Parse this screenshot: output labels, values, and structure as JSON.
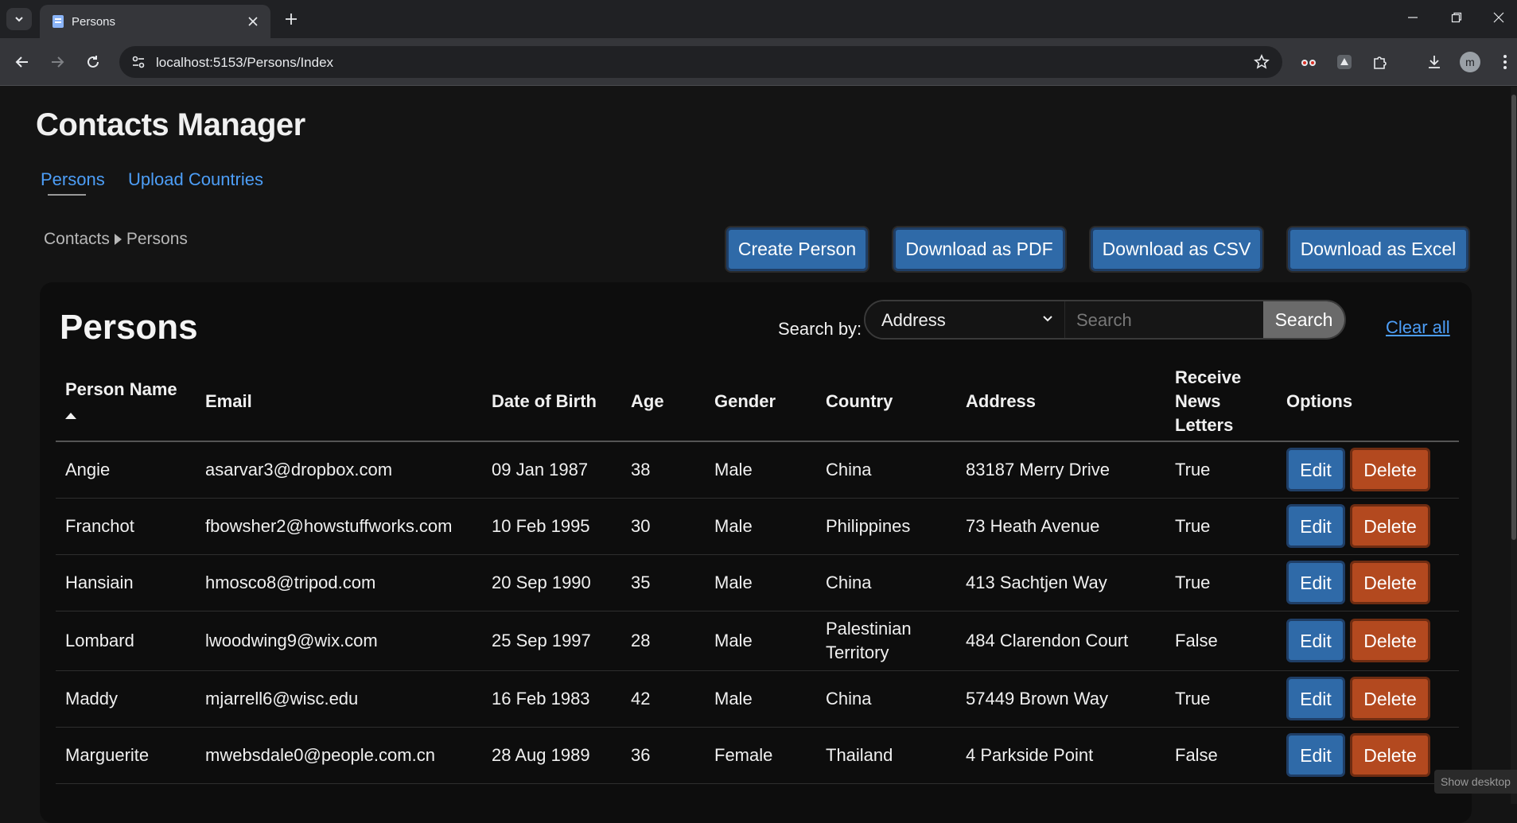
{
  "browser": {
    "tab_title": "Persons",
    "url": "localhost:5153/Persons/Index",
    "avatar_letter": "m"
  },
  "app": {
    "title": "Contacts Manager",
    "nav": [
      {
        "label": "Persons",
        "active": true
      },
      {
        "label": "Upload Countries",
        "active": false
      }
    ]
  },
  "breadcrumb": {
    "root": "Contacts",
    "current": "Persons"
  },
  "actions": {
    "create": "Create Person",
    "pdf": "Download as PDF",
    "csv": "Download as CSV",
    "excel": "Download as Excel"
  },
  "panel": {
    "title": "Persons",
    "search_label": "Search by:",
    "search_by_value": "Address",
    "search_placeholder": "Search",
    "search_button": "Search",
    "clear_all": "Clear all"
  },
  "table": {
    "headers": {
      "name": "Person Name",
      "email": "Email",
      "dob": "Date of Birth",
      "age": "Age",
      "gender": "Gender",
      "country": "Country",
      "address": "Address",
      "news_1": "Receive",
      "news_2": "News",
      "news_3": "Letters",
      "options": "Options"
    },
    "edit_label": "Edit",
    "delete_label": "Delete",
    "rows": [
      {
        "name": "Angie",
        "email": "asarvar3@dropbox.com",
        "dob": "09 Jan 1987",
        "age": "38",
        "gender": "Male",
        "country": "China",
        "country_2": "",
        "address": "83187 Merry Drive",
        "news": "True"
      },
      {
        "name": "Franchot",
        "email": "fbowsher2@howstuffworks.com",
        "dob": "10 Feb 1995",
        "age": "30",
        "gender": "Male",
        "country": "Philippines",
        "country_2": "",
        "address": "73 Heath Avenue",
        "news": "True"
      },
      {
        "name": "Hansiain",
        "email": "hmosco8@tripod.com",
        "dob": "20 Sep 1990",
        "age": "35",
        "gender": "Male",
        "country": "China",
        "country_2": "",
        "address": "413 Sachtjen Way",
        "news": "True"
      },
      {
        "name": "Lombard",
        "email": "lwoodwing9@wix.com",
        "dob": "25 Sep 1997",
        "age": "28",
        "gender": "Male",
        "country": "Palestinian",
        "country_2": "Territory",
        "address": "484 Clarendon Court",
        "news": "False"
      },
      {
        "name": "Maddy",
        "email": "mjarrell6@wisc.edu",
        "dob": "16 Feb 1983",
        "age": "42",
        "gender": "Male",
        "country": "China",
        "country_2": "",
        "address": "57449 Brown Way",
        "news": "True"
      },
      {
        "name": "Marguerite",
        "email": "mwebsdale0@people.com.cn",
        "dob": "28 Aug 1989",
        "age": "36",
        "gender": "Female",
        "country": "Thailand",
        "country_2": "",
        "address": "4 Parkside Point",
        "news": "False"
      }
    ]
  },
  "taskbar": {
    "show_desktop": "Show desktop"
  }
}
